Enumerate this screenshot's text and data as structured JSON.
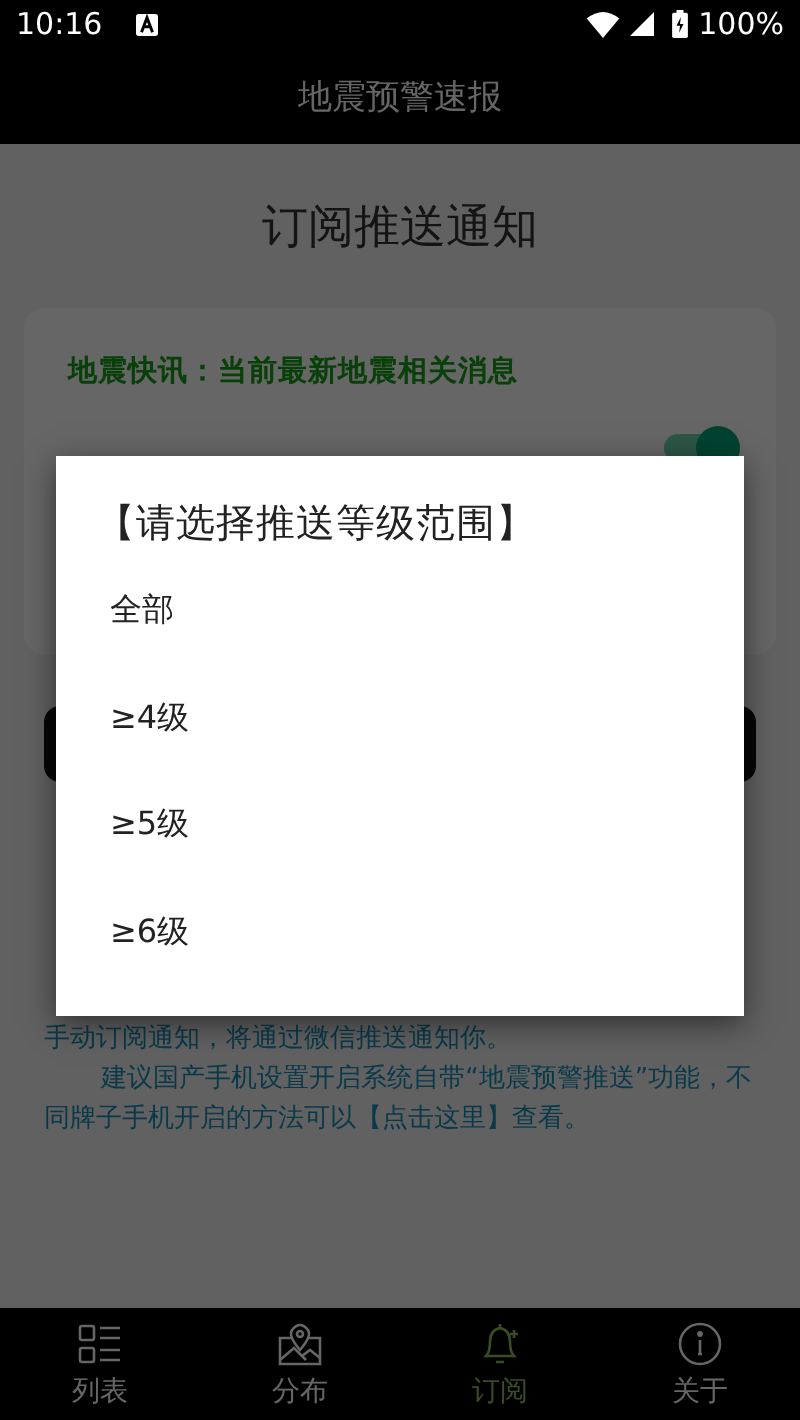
{
  "status_bar": {
    "time": "10:16",
    "battery": "100%"
  },
  "app_bar": {
    "title": "地震预警速报"
  },
  "page": {
    "title": "订阅推送通知",
    "card": {
      "headline": "地震快讯：当前最新地震相关消息",
      "subscription_on": true
    },
    "note_line": "手动订阅通知，将通过微信推送通知你。",
    "note_tip": {
      "before": "建议国产手机设置开启系统自带“地震预警推送”功能，不同牌子手机开启的方法可以",
      "link": "【点击这里】",
      "after": "查看。"
    }
  },
  "dialog": {
    "title": "【请选择推送等级范围】",
    "options": [
      {
        "label": "全部"
      },
      {
        "label": "≥4级"
      },
      {
        "label": "≥5级"
      },
      {
        "label": "≥6级"
      }
    ]
  },
  "bottom_nav": [
    {
      "kind": "list",
      "label": "列表",
      "selected": false
    },
    {
      "kind": "map",
      "label": "分布",
      "selected": false
    },
    {
      "kind": "bell",
      "label": "订阅",
      "selected": true
    },
    {
      "kind": "info",
      "label": "关于",
      "selected": false
    }
  ]
}
